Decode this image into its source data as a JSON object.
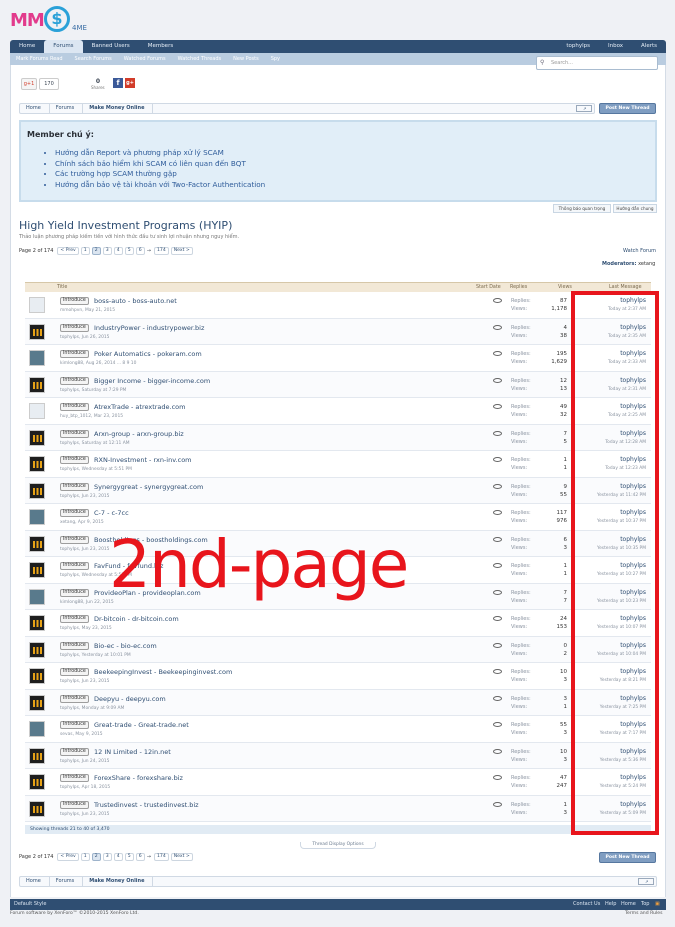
{
  "logo": {
    "text_mm": "MM",
    "text_dollar": "$",
    "text_4me": "4ME"
  },
  "nav": {
    "tabs": [
      "Home",
      "Forums",
      "Banned Users",
      "Members"
    ],
    "user": "tophylps",
    "inbox": "Inbox",
    "alerts": "Alerts"
  },
  "subnav": [
    "Mark Forums Read",
    "Search Forums",
    "Watched Forums",
    "Watched Threads",
    "New Posts",
    "Spy"
  ],
  "search": {
    "placeholder": "Search..."
  },
  "share": {
    "gplus": "g+1",
    "gplus_count": "170",
    "shares_count": "0",
    "shares_label": "Shares",
    "fb": "f",
    "gp": "g+"
  },
  "breadcrumb": [
    "Home",
    "Forums",
    "Make Money Online"
  ],
  "post_new_thread": "Post New Thread",
  "notice": {
    "heading": "Member chú ý:",
    "items": [
      "Hướng dẫn Report và phương pháp xử lý SCAM",
      "Chính sách bảo hiểm khi SCAM có liên quan đến BQT",
      "Các trường hợp SCAM thường gặp",
      "Hướng dẫn bảo vệ tài khoản với Two-Factor Authentication"
    ]
  },
  "notice_tabs": [
    "Thông báo quan trọng",
    "Hướng dẫn chung"
  ],
  "forum": {
    "title": "High Yield Investment Programs (HYIP)",
    "description": "Thảo luận phương pháp kiếm tiền với hình thức đầu tư sinh lợi nhuận nhưng nguy hiểm.",
    "watch": "Watch Forum",
    "moderators_label": "Moderators:",
    "moderator": "xetang"
  },
  "pager": {
    "label": "Page 2 of 174",
    "prev": "< Prev",
    "pages": [
      "1",
      "2",
      "3",
      "4",
      "5",
      "6"
    ],
    "arrow": "→",
    "last": "174",
    "next": "Next >",
    "current": "2"
  },
  "table_head": {
    "title": "Title",
    "start_date": "Start Date",
    "replies": "Replies",
    "views": "Views",
    "last_message": "Last Message"
  },
  "labels": {
    "replies": "Replies:",
    "views": "Views:"
  },
  "threads": [
    {
      "prefix": "Introduce",
      "title": "boss-auto - boss-auto.net",
      "meta": "mmohpvn, May 21, 2015",
      "replies": "87",
      "views": "1,178",
      "last_user": "tophylps",
      "last_time": "Today at 2:37 AM",
      "avatar": "alt"
    },
    {
      "prefix": "Introduce",
      "title": "IndustryPower - industrypower.biz",
      "meta": "tophylps, Jun 26, 2015",
      "replies": "4",
      "views": "38",
      "last_user": "tophylps",
      "last_time": "Today at 2:35 AM",
      "avatar": "bars"
    },
    {
      "prefix": "Introduce",
      "title": "Poker Automatics - pokeram.com",
      "meta": "kimlong88, Aug 26, 2014 ... 8 9 10",
      "replies": "195",
      "views": "1,629",
      "last_user": "tophylps",
      "last_time": "Today at 2:33 AM",
      "avatar": "alt2"
    },
    {
      "prefix": "Introduce",
      "title": "Bigger Income - bigger-income.com",
      "meta": "tophylps, Saturday at 7:29 PM",
      "replies": "12",
      "views": "13",
      "last_user": "tophylps",
      "last_time": "Today at 2:31 AM",
      "avatar": "bars"
    },
    {
      "prefix": "Introduce",
      "title": "AtrexTrade - atrextrade.com",
      "meta": "huy_btp_1012, Mar 23, 2015",
      "replies": "49",
      "views": "32",
      "last_user": "tophylps",
      "last_time": "Today at 2:25 AM",
      "avatar": "alt"
    },
    {
      "prefix": "Introduce",
      "title": "Arxn-group - arxn-group.biz",
      "meta": "tophylps, Saturday at 12:11 AM",
      "replies": "7",
      "views": "5",
      "last_user": "tophylps",
      "last_time": "Today at 12:28 AM",
      "avatar": "bars"
    },
    {
      "prefix": "Introduce",
      "title": "RXN-Investment - rxn-inv.com",
      "meta": "tophylps, Wednesday at 5:51 PM",
      "replies": "1",
      "views": "1",
      "last_user": "tophylps",
      "last_time": "Today at 12:23 AM",
      "avatar": "bars"
    },
    {
      "prefix": "Introduce",
      "title": "Synergygreat - synergygreat.com",
      "meta": "tophylps, Jun 23, 2015",
      "replies": "9",
      "views": "55",
      "last_user": "tophylps",
      "last_time": "Yesterday at 11:42 PM",
      "avatar": "bars"
    },
    {
      "prefix": "Introduce",
      "title": "C-7 - c-7cc",
      "meta": "xetang, Apr 9, 2015",
      "replies": "117",
      "views": "976",
      "last_user": "tophylps",
      "last_time": "Yesterday at 10:37 PM",
      "avatar": "alt2"
    },
    {
      "prefix": "Introduce",
      "title": "Boostholdings - boostholdings.com",
      "meta": "tophylps, Jun 23, 2015",
      "replies": "6",
      "views": "3",
      "last_user": "tophylps",
      "last_time": "Yesterday at 10:35 PM",
      "avatar": "bars"
    },
    {
      "prefix": "Introduce",
      "title": "FavFund - favfund.biz",
      "meta": "tophylps, Wednesday at 5:55 PM",
      "replies": "1",
      "views": "1",
      "last_user": "tophylps",
      "last_time": "Yesterday at 10:27 PM",
      "avatar": "bars"
    },
    {
      "prefix": "Introduce",
      "title": "ProvideoPlan - provideoplan.com",
      "meta": "kimlong88, Jun 22, 2015",
      "replies": "7",
      "views": "7",
      "last_user": "tophylps",
      "last_time": "Yesterday at 10:23 PM",
      "avatar": "alt2"
    },
    {
      "prefix": "Introduce",
      "title": "Dr-bitcoin - dr-bitcoin.com",
      "meta": "tophylps, May 23, 2015",
      "replies": "24",
      "views": "153",
      "last_user": "tophylps",
      "last_time": "Yesterday at 10:07 PM",
      "avatar": "bars"
    },
    {
      "prefix": "Introduce",
      "title": "Bio-ec - bio-ec.com",
      "meta": "tophylps, Yesterday at 10:01 PM",
      "replies": "0",
      "views": "2",
      "last_user": "tophylps",
      "last_time": "Yesterday at 10:04 PM",
      "avatar": "bars"
    },
    {
      "prefix": "Introduce",
      "title": "BeekeepingInvest - Beekeepinginvest.com",
      "meta": "tophylps, Jun 23, 2015",
      "replies": "10",
      "views": "3",
      "last_user": "tophylps",
      "last_time": "Yesterday at 8:21 PM",
      "avatar": "bars"
    },
    {
      "prefix": "Introduce",
      "title": "Deepyu - deepyu.com",
      "meta": "tophylps, Monday at 9:09 AM",
      "replies": "3",
      "views": "1",
      "last_user": "tophylps",
      "last_time": "Yesterday at 7:25 PM",
      "avatar": "bars"
    },
    {
      "prefix": "Introduce",
      "title": "Great-trade - Great-trade.net",
      "meta": "sevas, May 9, 2015",
      "replies": "55",
      "views": "3",
      "last_user": "tophylps",
      "last_time": "Yesterday at 7:17 PM",
      "avatar": "alt2"
    },
    {
      "prefix": "Introduce",
      "title": "12 IN Limited - 12in.net",
      "meta": "tophylps, Jun 24, 2015",
      "replies": "10",
      "views": "3",
      "last_user": "tophylps",
      "last_time": "Yesterday at 5:36 PM",
      "avatar": "bars"
    },
    {
      "prefix": "Introduce",
      "title": "ForexShare - forexshare.biz",
      "meta": "tophylps, Apr 18, 2015",
      "replies": "47",
      "views": "247",
      "last_user": "tophylps",
      "last_time": "Yesterday at 5:24 PM",
      "avatar": "bars"
    },
    {
      "prefix": "Introduce",
      "title": "Trustedinvest - trustedinvest.biz",
      "meta": "tophylps, Jun 23, 2015",
      "replies": "1",
      "views": "3",
      "last_user": "tophylps",
      "last_time": "Yesterday at 5:09 PM",
      "avatar": "bars"
    }
  ],
  "showing": "Showing threads 21 to 40 of 3,470",
  "thread_display_options": "Thread Display Options",
  "overlay_text": "2nd-page",
  "footer": {
    "style": "Default Style",
    "links": [
      "Contact Us",
      "Help",
      "Home",
      "Top"
    ],
    "copyright": "Forum software by XenForo™ ©2010-2015 XenForo Ltd.",
    "terms": "Terms and Rules"
  },
  "colors": {
    "nav": "#2f4e72",
    "annotation": "#e8151c",
    "link": "#2f4e72",
    "notice_bg": "#e1eef8"
  }
}
